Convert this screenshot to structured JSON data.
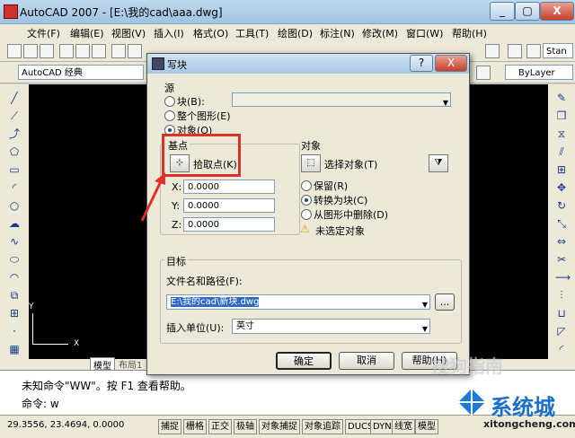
{
  "window": {
    "title": "AutoCAD 2007 - [E:\\我的cad\\aaa.dwg]",
    "minimize": "_",
    "restore": "▢",
    "close": "X"
  },
  "menu": [
    "文件(F)",
    "编辑(E)",
    "视图(V)",
    "插入(I)",
    "格式(O)",
    "工具(T)",
    "绘图(D)",
    "标注(N)",
    "修改(M)",
    "窗口(W)",
    "帮助(H)"
  ],
  "toolbar": {
    "workspace": "AutoCAD 经典",
    "layer": "ByLayer",
    "style": "Stan"
  },
  "drawing": {
    "axis_y": "Y",
    "axis_x": "X",
    "tabs": [
      "模型",
      "布局1"
    ]
  },
  "command": {
    "line1": "未知命令\"WW\"。按 F1 查看帮助。",
    "line2": "命令: w"
  },
  "status": {
    "coords": "29.3556, 23.4694, 0.0000",
    "buttons": [
      "捕捉",
      "栅格",
      "正交",
      "极轴",
      "对象捕捉",
      "对象追踪",
      "DUCS",
      "DYN",
      "线宽",
      "模型"
    ]
  },
  "dialog": {
    "title": "写块",
    "help": "?",
    "close": "X",
    "source": {
      "label": "源",
      "block": "块(B):",
      "entire": "整个图形(E)",
      "objects": "对象(O)"
    },
    "base_point": {
      "label": "基点",
      "pick": "拾取点(K)",
      "x_label": "X:",
      "x": "0.0000",
      "y_label": "Y:",
      "y": "0.0000",
      "z_label": "Z:",
      "z": "0.0000"
    },
    "objects": {
      "label": "对象",
      "select": "选择对象(T)",
      "retain": "保留(R)",
      "convert": "转换为块(C)",
      "delete": "从图形中删除(D)",
      "warning": "未选定对象"
    },
    "destination": {
      "label": "目标",
      "path_label": "文件名和路径(F):",
      "path": "E:\\我的cad\\新块.dwg",
      "browse": "...",
      "units_label": "插入单位(U):",
      "units": "英寸"
    },
    "buttons": {
      "ok": "确定",
      "cancel": "取消",
      "help": "帮助(H)"
    }
  },
  "watermark": {
    "sogou": "搜狗指南",
    "brand": "系统城",
    "url": "xitongcheng.com"
  }
}
